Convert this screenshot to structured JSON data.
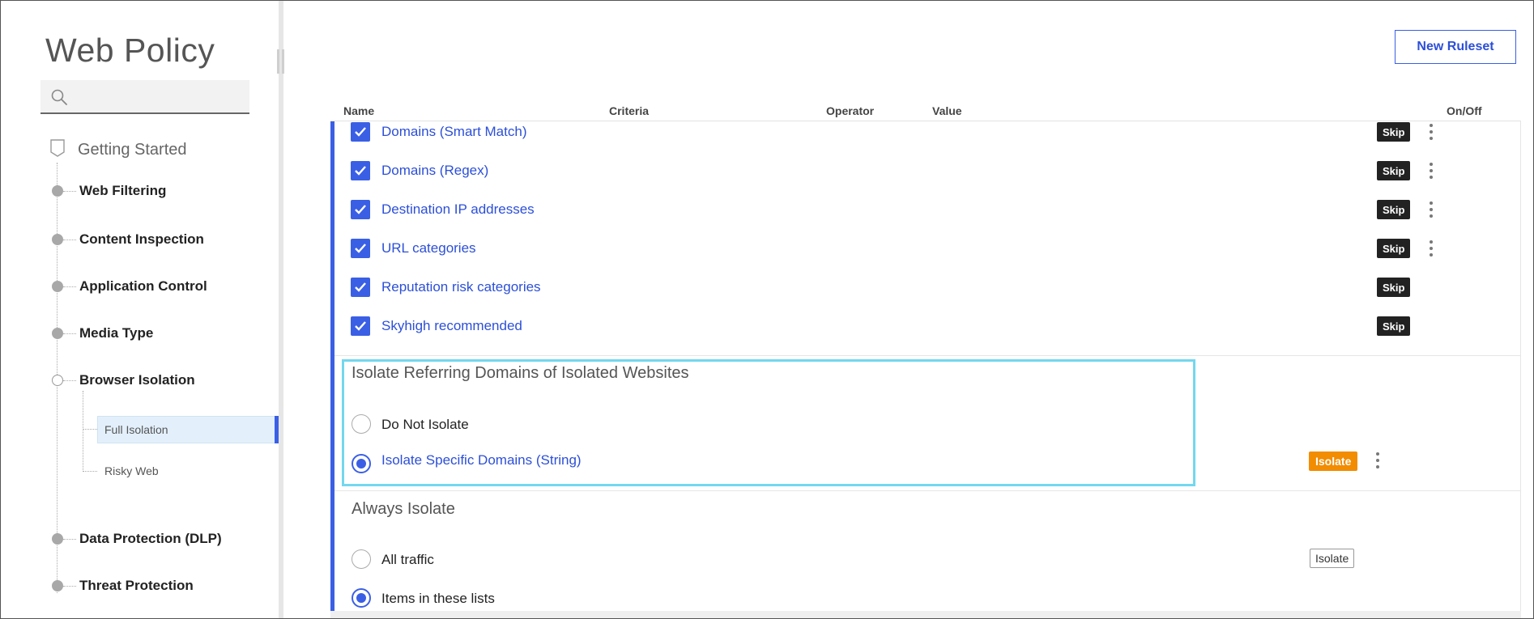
{
  "sidebar": {
    "title": "Web Policy",
    "search_placeholder": "",
    "getting_started": "Getting Started",
    "items": [
      {
        "label": "Web Filtering"
      },
      {
        "label": "Content Inspection"
      },
      {
        "label": "Application Control"
      },
      {
        "label": "Media Type"
      },
      {
        "label": "Browser Isolation"
      },
      {
        "label": "Data Protection (DLP)"
      },
      {
        "label": "Threat Protection"
      }
    ],
    "sub_items": [
      {
        "label": "Full Isolation",
        "active": true
      },
      {
        "label": "Risky Web",
        "active": false
      }
    ]
  },
  "toolbar": {
    "new_ruleset_label": "New Ruleset"
  },
  "table": {
    "columns": [
      "Name",
      "Criteria",
      "Operator",
      "Value",
      "On/Off"
    ]
  },
  "rules": [
    {
      "name": "Domains (Smart Match)",
      "badge": "Skip",
      "menu": true
    },
    {
      "name": "Domains (Regex)",
      "badge": "Skip",
      "menu": true
    },
    {
      "name": "Destination IP addresses",
      "badge": "Skip",
      "menu": true
    },
    {
      "name": "URL categories",
      "badge": "Skip",
      "menu": true
    },
    {
      "name": "Reputation risk categories",
      "badge": "Skip",
      "menu": false
    },
    {
      "name": "Skyhigh recommended",
      "badge": "Skip",
      "menu": false
    }
  ],
  "sections": [
    {
      "title": "Isolate Referring Domains of Isolated Websites",
      "options": [
        {
          "label": "Do Not Isolate",
          "selected": false
        },
        {
          "label": "Isolate Specific Domains (String)",
          "selected": true,
          "badge": "Isolate"
        }
      ]
    },
    {
      "title": "Always Isolate",
      "options": [
        {
          "label": "All traffic",
          "selected": false,
          "badge": "Isolate"
        },
        {
          "label": "Items in these lists",
          "selected": true
        }
      ]
    }
  ],
  "colors": {
    "accent": "#3a5fe5",
    "link": "#2c4fd8",
    "highlight_border": "#72d8ee",
    "isolate_badge": "#f28c00",
    "skip_badge": "#222222"
  }
}
